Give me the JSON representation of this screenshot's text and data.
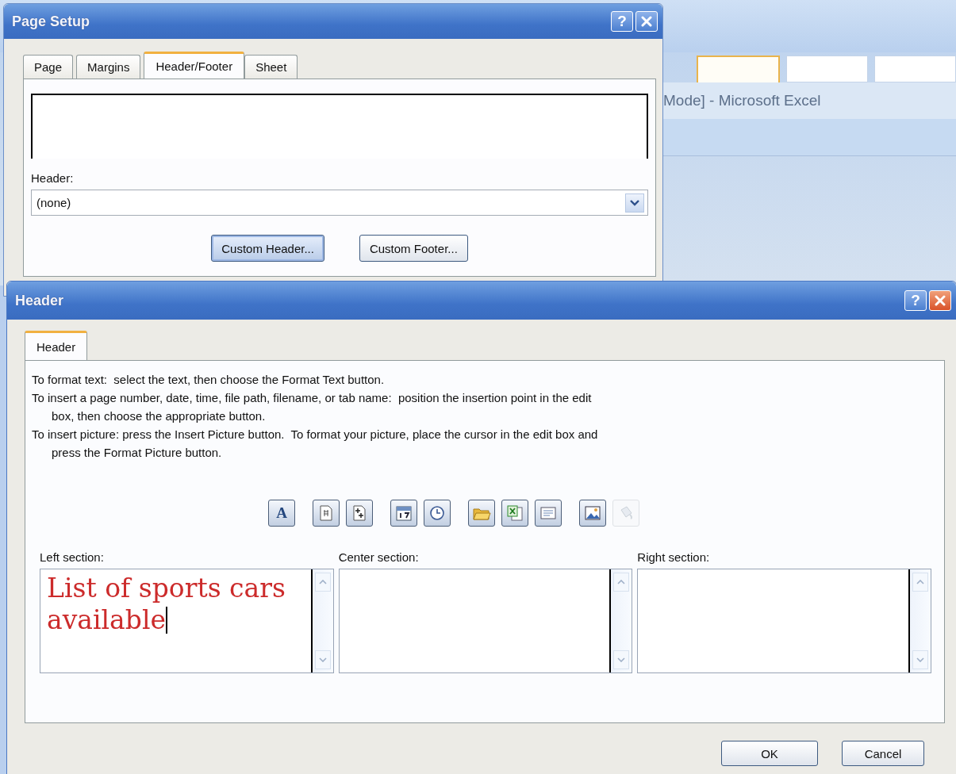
{
  "background_window": {
    "ribbon_tabs": [
      {
        "selected": true
      },
      {
        "selected": false
      },
      {
        "selected": false
      }
    ],
    "title": "Mode] - Microsoft Excel"
  },
  "page_setup": {
    "title": "Page Setup",
    "help_button": "?",
    "tabs": [
      {
        "label": "Page",
        "selected": false
      },
      {
        "label": "Margins",
        "selected": false
      },
      {
        "label": "Header/Footer",
        "selected": true
      },
      {
        "label": "Sheet",
        "selected": false
      }
    ],
    "header_label": "Header:",
    "header_dropdown": {
      "value": "(none)"
    },
    "buttons": [
      {
        "label": "Custom Header...",
        "focused": true
      },
      {
        "label": "Custom Footer...",
        "focused": false
      }
    ]
  },
  "header_dialog": {
    "title": "Header",
    "help_button": "?",
    "tabs": [
      {
        "label": "Header",
        "selected": true
      }
    ],
    "instructions": [
      "To format text:  select the text, then choose the Format Text button.",
      "To insert a page number, date, time, file path, filename, or tab name:  position the insertion point in the edit box, then choose the appropriate button.",
      "To insert picture: press the Insert Picture button.  To format your picture, place the cursor in the edit box and press the Format Picture button."
    ],
    "toolbar_groups": [
      {
        "buttons": [
          {
            "label": "A",
            "disabled": false
          }
        ]
      },
      {
        "buttons": [
          {
            "disabled": false
          },
          {
            "disabled": false
          }
        ]
      },
      {
        "buttons": [
          {
            "disabled": false
          },
          {
            "disabled": false
          }
        ]
      },
      {
        "buttons": [
          {
            "disabled": false
          },
          {
            "disabled": false
          },
          {
            "disabled": false
          }
        ]
      },
      {
        "buttons": [
          {
            "disabled": false
          },
          {
            "disabled": true
          }
        ]
      }
    ],
    "sections": [
      {
        "label": "Left section:",
        "text": "List of sports cars available",
        "focused": true
      },
      {
        "label": "Center section:",
        "focused": false
      },
      {
        "label": "Right section:",
        "focused": false
      }
    ],
    "buttons": [
      "OK",
      "Cancel"
    ]
  }
}
